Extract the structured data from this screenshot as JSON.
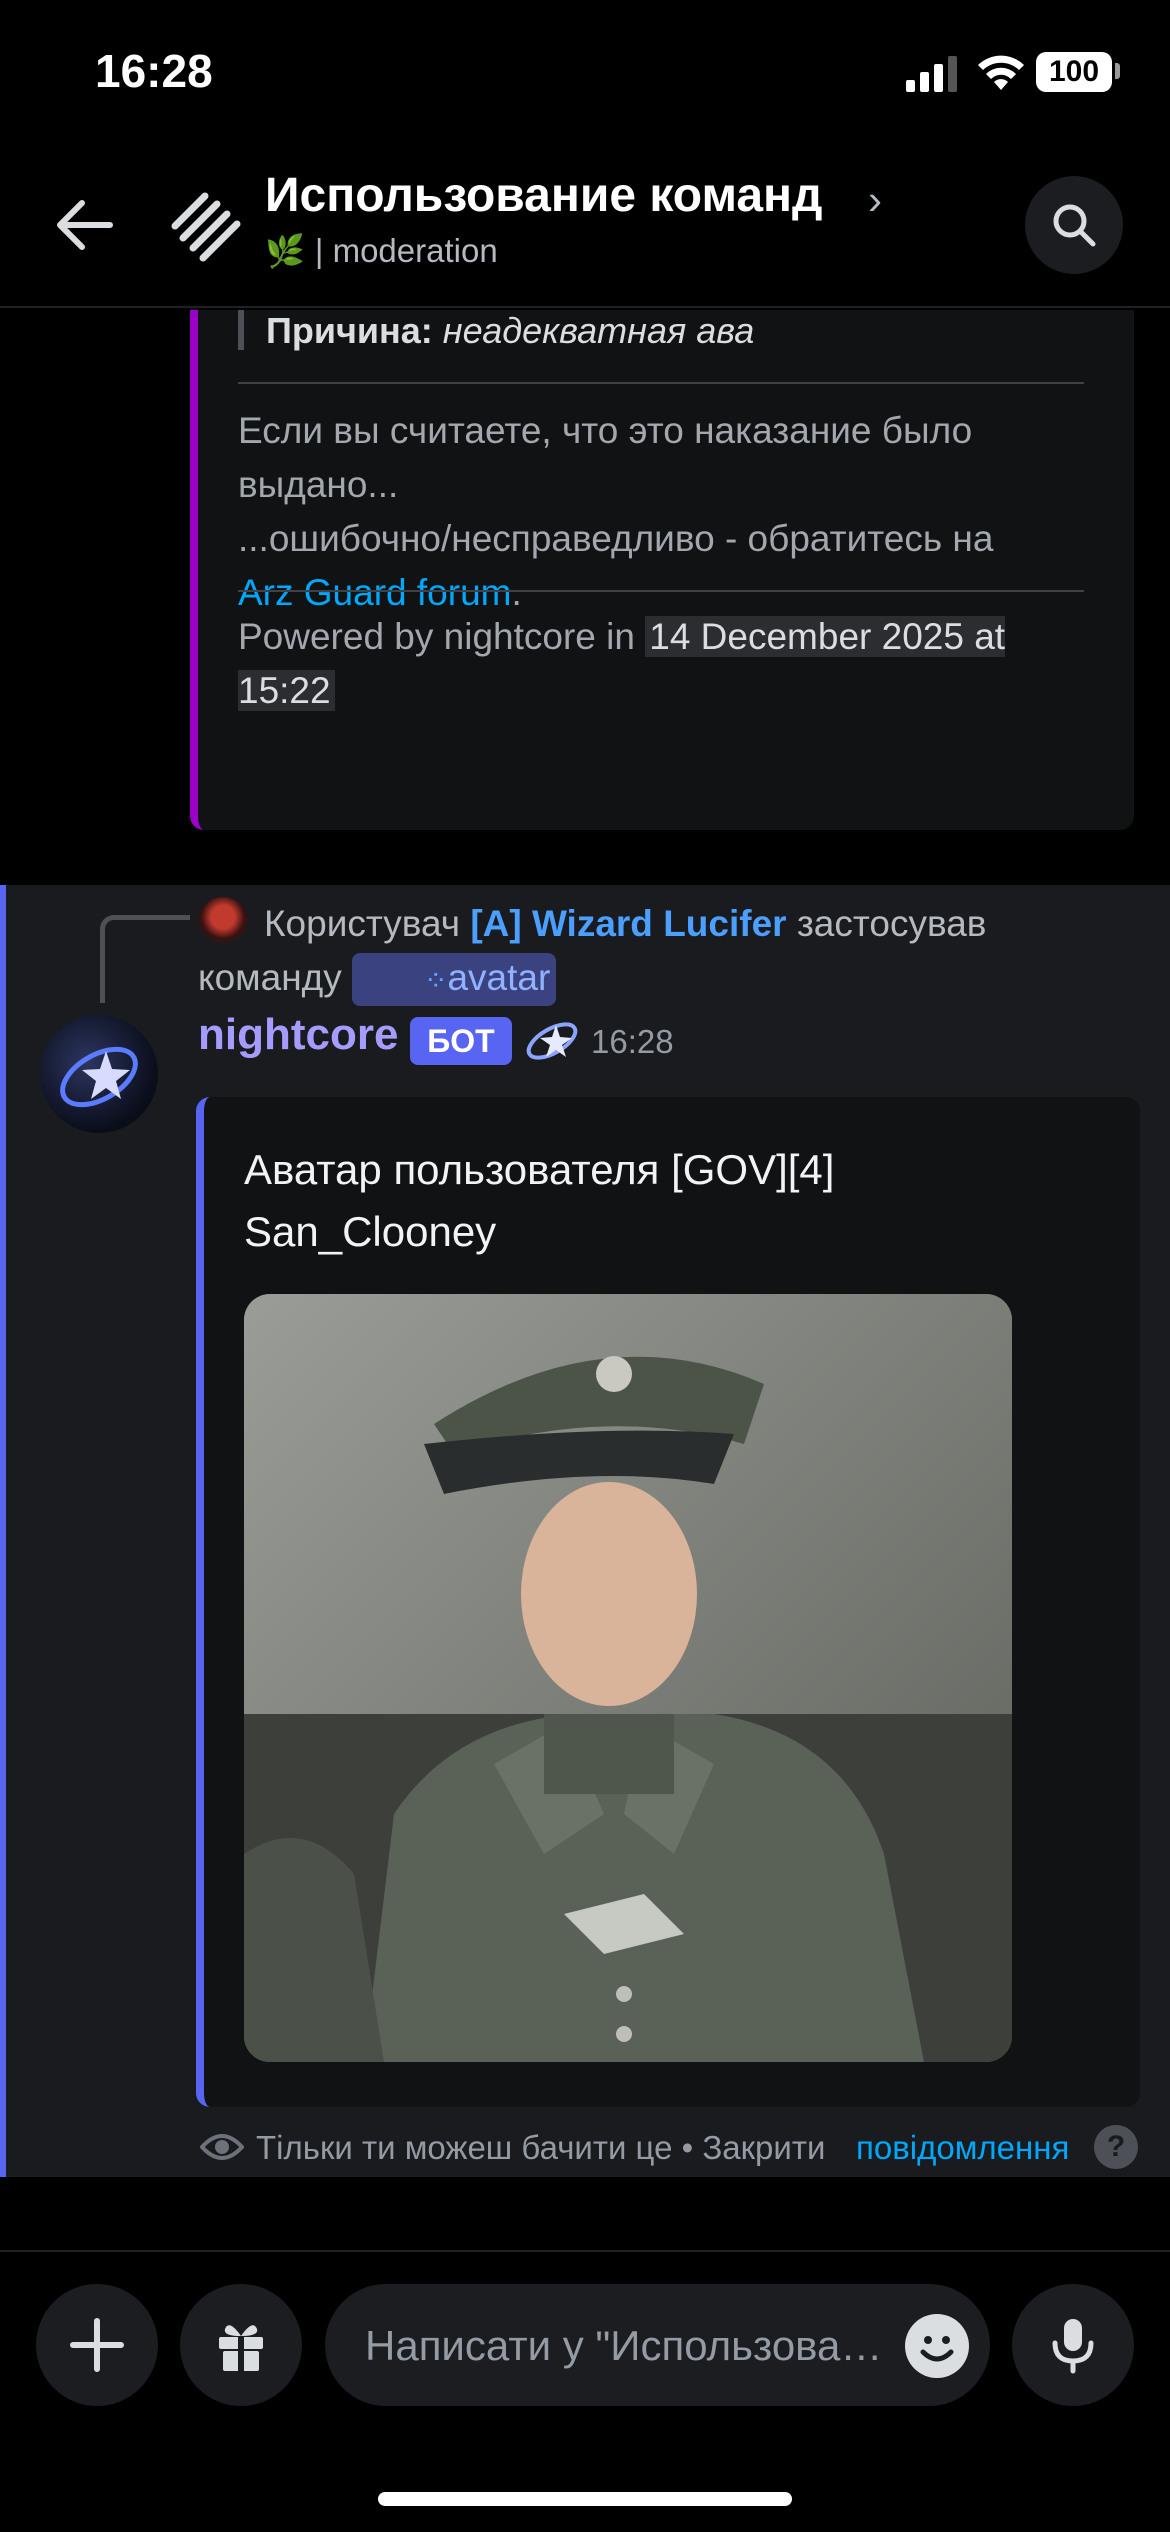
{
  "status_bar": {
    "time": "16:28",
    "battery": "100"
  },
  "header": {
    "title": "Использование команд",
    "chevron": "›",
    "subtitle_leaf": "🌿",
    "subtitle": "| moderation"
  },
  "embed_punishment": {
    "reason_label": "Причина:",
    "reason_value": "неадекватная ава",
    "appeal_line1": "Если вы считаете, что это наказание было выдано...",
    "appeal_line2": "...ошибочно/несправедливо - обратитесь на",
    "appeal_link": "Arz Guard forum",
    "appeal_end": ".",
    "footer_prefix": "Powered by nightcore in",
    "footer_timestamp": "14 December 2025 at 15:22"
  },
  "command_reply": {
    "prefix": "Користувач",
    "user": "[A] Wizard Lucifer",
    "middle": "застосував команду",
    "command": "avatar"
  },
  "bot_message": {
    "author": "nightcore",
    "badge": "БОТ",
    "time": "16:28",
    "embed_title": "Аватар пользователя [GOV][4] San_Clooney"
  },
  "ephemeral": {
    "text": "Тільки ти можеш бачити це • Закрити",
    "link": "повідомлення",
    "help": "?"
  },
  "composer": {
    "placeholder": "Написати у \"Использование команд\""
  },
  "colors": {
    "accent": "#5865f2",
    "embed_punishment_border": "#9c00c8",
    "link": "#00a8fc",
    "bot_name": "#a59cff"
  },
  "icons": [
    "back-arrow-icon",
    "channel-icon",
    "search-icon",
    "plus-icon",
    "gift-icon",
    "emoji-icon",
    "microphone-icon",
    "eye-icon",
    "help-icon"
  ]
}
